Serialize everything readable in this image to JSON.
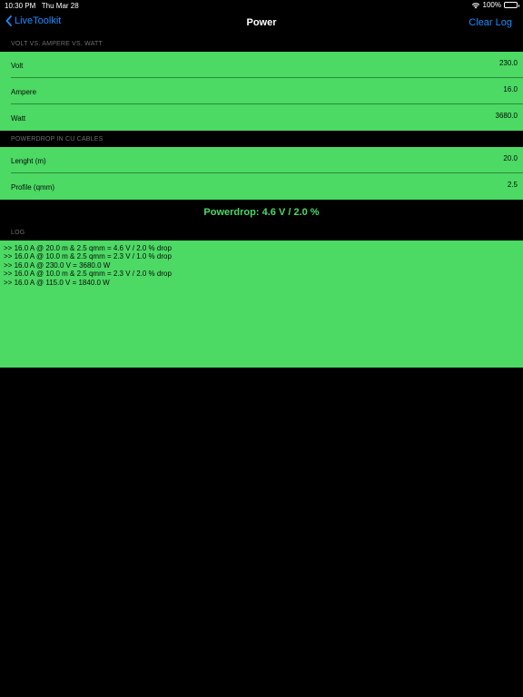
{
  "status_bar": {
    "time": "10:30 PM",
    "date": "Thu Mar 28",
    "battery": "100%",
    "wifi_icon": "wifi-icon",
    "battery_icon": "battery-icon"
  },
  "nav": {
    "back_label": "LiveToolkit",
    "back_icon": "chevron-left-icon",
    "title": "Power",
    "clear_label": "Clear Log"
  },
  "section_power": {
    "header": "VOLT VS. AMPERE VS. WATT",
    "rows": [
      {
        "label": "Volt",
        "value": "230.0"
      },
      {
        "label": "Ampere",
        "value": "16.0"
      },
      {
        "label": "Watt",
        "value": "3680.0"
      }
    ]
  },
  "section_cables": {
    "header": "POWERDROP IN CU CABLES",
    "rows": [
      {
        "label": "Lenght (m)",
        "value": "20.0"
      },
      {
        "label": "Profile (qmm)",
        "value": "2.5"
      }
    ]
  },
  "result": {
    "text": "Powerdrop: 4.6 V / 2.0 %"
  },
  "log": {
    "header": "LOG",
    "lines": [
      ">> 16.0 A @ 20.0 m & 2.5 qmm = 4.6 V / 2.0 % drop",
      ">> 16.0 A @ 10.0 m & 2.5 qmm = 2.3 V / 1.0 % drop",
      ">> 16.0 A @ 230.0 V = 3680.0 W",
      ">> 16.0 A @ 10.0 m & 2.5 qmm = 2.3 V / 2.0 % drop",
      ">> 16.0 A @ 115.0 V = 1840.0 W"
    ]
  },
  "colors": {
    "background": "#000000",
    "accent_green": "#4cd964",
    "link_blue": "#1a8cff",
    "header_gray": "#6f6f6f"
  }
}
